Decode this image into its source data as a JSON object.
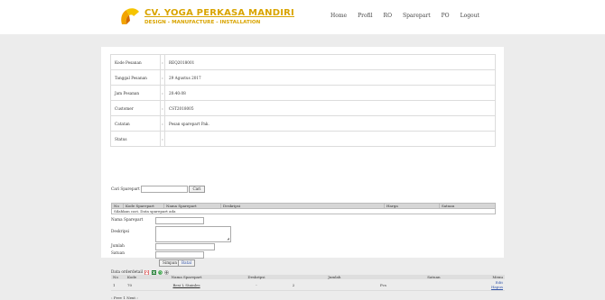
{
  "header": {
    "logo_title": "CV. YOGA PERKASA MANDIRI",
    "logo_subtitle": "DESIGN - MANUFACTURE - INSTALLATION",
    "nav": [
      "Home",
      "Profil",
      "RO",
      "Sparepart",
      "PO",
      "Logout"
    ]
  },
  "info": {
    "rows": [
      {
        "label": "Kode Pesanan",
        "value": "REQ2018001"
      },
      {
        "label": "Tanggal Pesanan",
        "value": "29 Agustus 2017"
      },
      {
        "label": "Jam Pesanan",
        "value": "20:40:08"
      },
      {
        "label": "Customer",
        "value": "CST2018005"
      },
      {
        "label": "Catatan",
        "value": "Pesan sparepart Pak."
      },
      {
        "label": "Status",
        "value": ""
      }
    ],
    "separator": ":"
  },
  "search": {
    "label": "Cari Sparepart",
    "value": "",
    "button": "Cari"
  },
  "results": {
    "columns": [
      "No",
      "Kode Sparepart",
      "Nama Sparepart",
      "Deskripsi",
      "Harga",
      "Satuan"
    ],
    "empty_message": "Silahkan cari. Data sparepart ada"
  },
  "form": {
    "nama_label": "Nama Sparepart",
    "deskripsi_label": "Deskripsi",
    "jumlah_label": "Jumlah",
    "satuan_label": "Satuan",
    "simpan_button": "Simpan",
    "batal_button": "Batal"
  },
  "detail": {
    "label": "Data orderdetail",
    "columns": [
      "No",
      "Kode",
      "Nama Sparepart",
      "Deskripsi",
      "Jumlah",
      "Satuan",
      "Menu"
    ],
    "rows": [
      {
        "no": "1",
        "kode": "70",
        "nama": "Besi L Stainles",
        "deskripsi": "-",
        "jumlah": "2",
        "satuan": "Pcs",
        "edit": "Edit",
        "hapus": "Hapus"
      }
    ]
  },
  "pager": {
    "text": "‹ Prev 1 Next ›"
  },
  "colors": {
    "brand": "#d9a400",
    "link": "#3355aa"
  }
}
